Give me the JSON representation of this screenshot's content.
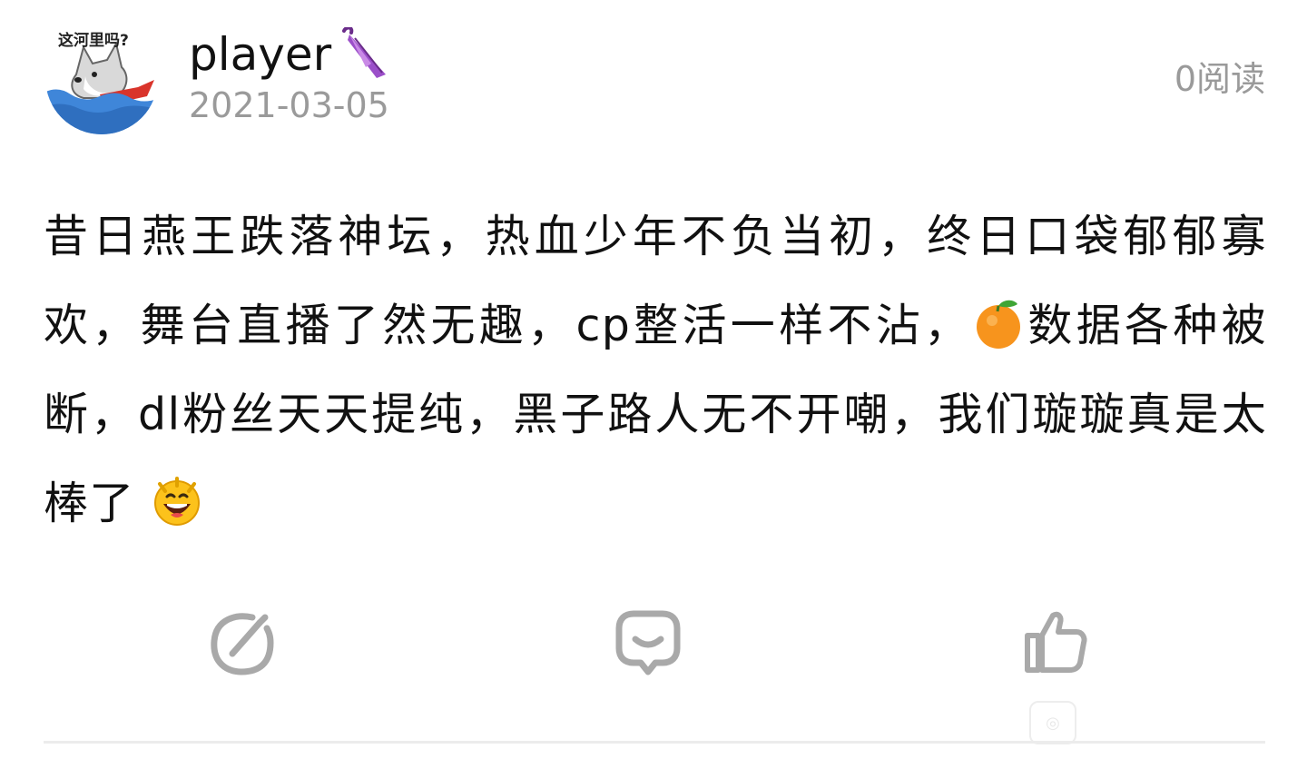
{
  "post": {
    "avatar_caption": "这河里吗?",
    "user_name": "player",
    "user_name_emoji": "closed-umbrella-icon",
    "date": "2021-03-05",
    "read_count": "0阅读",
    "body_parts": [
      "昔日燕王跌落神坛，热血少年不负当初，终日口袋郁郁寡欢，舞台直播了然无趣，cp整活一样不沾，",
      "数据各种被断，dl粉丝天天提纯，黑子路人无不开嘲，我们璇璇真是太棒了"
    ],
    "inline_emojis": [
      "tangerine-icon",
      "grinning-face-icon"
    ]
  },
  "actions": [
    {
      "name": "share",
      "icon": "share-edit-icon"
    },
    {
      "name": "comment",
      "icon": "comment-bubble-icon"
    },
    {
      "name": "like",
      "icon": "thumbs-up-icon"
    }
  ],
  "colors": {
    "text": "#111111",
    "meta": "#9a9a9a",
    "icon": "#a9a9a9",
    "divider": "#ececec"
  }
}
